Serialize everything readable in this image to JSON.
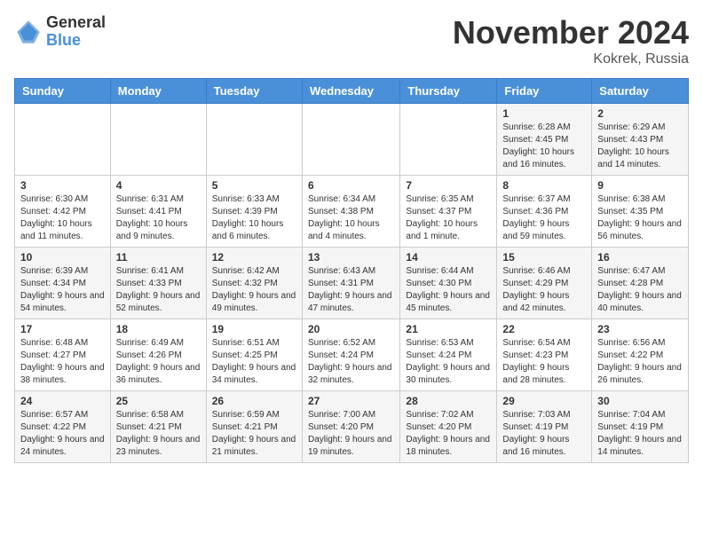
{
  "logo": {
    "general": "General",
    "blue": "Blue"
  },
  "title": {
    "month": "November 2024",
    "location": "Kokrek, Russia"
  },
  "headers": [
    "Sunday",
    "Monday",
    "Tuesday",
    "Wednesday",
    "Thursday",
    "Friday",
    "Saturday"
  ],
  "weeks": [
    [
      {
        "day": "",
        "info": ""
      },
      {
        "day": "",
        "info": ""
      },
      {
        "day": "",
        "info": ""
      },
      {
        "day": "",
        "info": ""
      },
      {
        "day": "",
        "info": ""
      },
      {
        "day": "1",
        "info": "Sunrise: 6:28 AM\nSunset: 4:45 PM\nDaylight: 10 hours and 16 minutes."
      },
      {
        "day": "2",
        "info": "Sunrise: 6:29 AM\nSunset: 4:43 PM\nDaylight: 10 hours and 14 minutes."
      }
    ],
    [
      {
        "day": "3",
        "info": "Sunrise: 6:30 AM\nSunset: 4:42 PM\nDaylight: 10 hours and 11 minutes."
      },
      {
        "day": "4",
        "info": "Sunrise: 6:31 AM\nSunset: 4:41 PM\nDaylight: 10 hours and 9 minutes."
      },
      {
        "day": "5",
        "info": "Sunrise: 6:33 AM\nSunset: 4:39 PM\nDaylight: 10 hours and 6 minutes."
      },
      {
        "day": "6",
        "info": "Sunrise: 6:34 AM\nSunset: 4:38 PM\nDaylight: 10 hours and 4 minutes."
      },
      {
        "day": "7",
        "info": "Sunrise: 6:35 AM\nSunset: 4:37 PM\nDaylight: 10 hours and 1 minute."
      },
      {
        "day": "8",
        "info": "Sunrise: 6:37 AM\nSunset: 4:36 PM\nDaylight: 9 hours and 59 minutes."
      },
      {
        "day": "9",
        "info": "Sunrise: 6:38 AM\nSunset: 4:35 PM\nDaylight: 9 hours and 56 minutes."
      }
    ],
    [
      {
        "day": "10",
        "info": "Sunrise: 6:39 AM\nSunset: 4:34 PM\nDaylight: 9 hours and 54 minutes."
      },
      {
        "day": "11",
        "info": "Sunrise: 6:41 AM\nSunset: 4:33 PM\nDaylight: 9 hours and 52 minutes."
      },
      {
        "day": "12",
        "info": "Sunrise: 6:42 AM\nSunset: 4:32 PM\nDaylight: 9 hours and 49 minutes."
      },
      {
        "day": "13",
        "info": "Sunrise: 6:43 AM\nSunset: 4:31 PM\nDaylight: 9 hours and 47 minutes."
      },
      {
        "day": "14",
        "info": "Sunrise: 6:44 AM\nSunset: 4:30 PM\nDaylight: 9 hours and 45 minutes."
      },
      {
        "day": "15",
        "info": "Sunrise: 6:46 AM\nSunset: 4:29 PM\nDaylight: 9 hours and 42 minutes."
      },
      {
        "day": "16",
        "info": "Sunrise: 6:47 AM\nSunset: 4:28 PM\nDaylight: 9 hours and 40 minutes."
      }
    ],
    [
      {
        "day": "17",
        "info": "Sunrise: 6:48 AM\nSunset: 4:27 PM\nDaylight: 9 hours and 38 minutes."
      },
      {
        "day": "18",
        "info": "Sunrise: 6:49 AM\nSunset: 4:26 PM\nDaylight: 9 hours and 36 minutes."
      },
      {
        "day": "19",
        "info": "Sunrise: 6:51 AM\nSunset: 4:25 PM\nDaylight: 9 hours and 34 minutes."
      },
      {
        "day": "20",
        "info": "Sunrise: 6:52 AM\nSunset: 4:24 PM\nDaylight: 9 hours and 32 minutes."
      },
      {
        "day": "21",
        "info": "Sunrise: 6:53 AM\nSunset: 4:24 PM\nDaylight: 9 hours and 30 minutes."
      },
      {
        "day": "22",
        "info": "Sunrise: 6:54 AM\nSunset: 4:23 PM\nDaylight: 9 hours and 28 minutes."
      },
      {
        "day": "23",
        "info": "Sunrise: 6:56 AM\nSunset: 4:22 PM\nDaylight: 9 hours and 26 minutes."
      }
    ],
    [
      {
        "day": "24",
        "info": "Sunrise: 6:57 AM\nSunset: 4:22 PM\nDaylight: 9 hours and 24 minutes."
      },
      {
        "day": "25",
        "info": "Sunrise: 6:58 AM\nSunset: 4:21 PM\nDaylight: 9 hours and 23 minutes."
      },
      {
        "day": "26",
        "info": "Sunrise: 6:59 AM\nSunset: 4:21 PM\nDaylight: 9 hours and 21 minutes."
      },
      {
        "day": "27",
        "info": "Sunrise: 7:00 AM\nSunset: 4:20 PM\nDaylight: 9 hours and 19 minutes."
      },
      {
        "day": "28",
        "info": "Sunrise: 7:02 AM\nSunset: 4:20 PM\nDaylight: 9 hours and 18 minutes."
      },
      {
        "day": "29",
        "info": "Sunrise: 7:03 AM\nSunset: 4:19 PM\nDaylight: 9 hours and 16 minutes."
      },
      {
        "day": "30",
        "info": "Sunrise: 7:04 AM\nSunset: 4:19 PM\nDaylight: 9 hours and 14 minutes."
      }
    ]
  ]
}
